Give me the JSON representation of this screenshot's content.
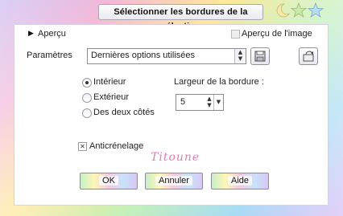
{
  "window": {
    "title": "Sélectionner les bordures de la sélection"
  },
  "header": {
    "apercu_label": "Aperçu",
    "apercu_image_label": "Aperçu de l'image",
    "apercu_image_checked": false
  },
  "parametres": {
    "label": "Paramètres",
    "preset_value": "Dernières options utilisées"
  },
  "options": {
    "interieur": "Intérieur",
    "exterieur": "Extérieur",
    "deux_cotes": "Des deux côtés",
    "selected": "interieur"
  },
  "border": {
    "label": "Largeur de la bordure :",
    "value": "5"
  },
  "antialias": {
    "label": "Anticrénelage",
    "checked": true
  },
  "signature": "Titoune",
  "buttons": {
    "ok": "OK",
    "cancel": "Annuler",
    "help": "Aide"
  },
  "icons": {
    "moon": "moon-icon",
    "star": "star-icon",
    "save": "save-preset-icon",
    "reset": "reset-icon"
  },
  "colors": {
    "accent_pink": "#e07ab8",
    "border": "#8a8a9a"
  }
}
